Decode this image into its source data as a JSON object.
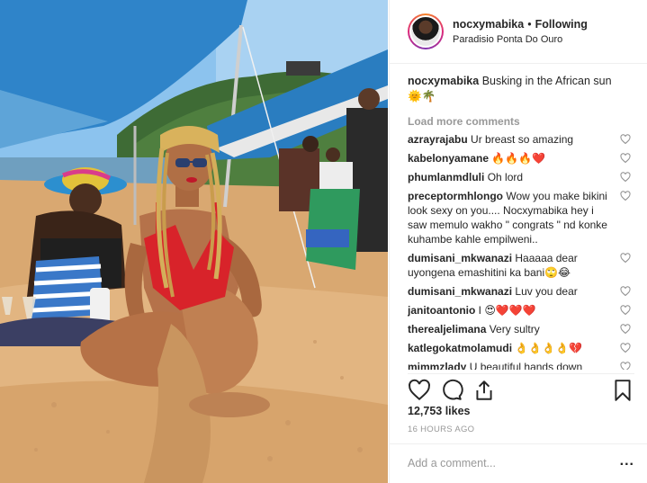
{
  "post": {
    "username": "nocxymabika",
    "dot": "•",
    "following_label": "Following",
    "location": "Paradisio Ponta Do Ouro",
    "caption_username": "nocxymabika",
    "caption_text": "Busking in the African sun 🌞🌴",
    "load_more_label": "Load more comments",
    "likes": "12,753 likes",
    "timestamp": "16 HOURS AGO",
    "comment_placeholder": "Add a comment...",
    "more_options": "..."
  },
  "comments": [
    {
      "user": "azrayrajabu",
      "text": "Ur breast so amazing"
    },
    {
      "user": "kabelonyamane",
      "text": "🔥🔥🔥❤️"
    },
    {
      "user": "phumlanmdluli",
      "text": "Oh lord"
    },
    {
      "user": "preceptormhlongo",
      "text": "Wow you make bikini look sexy on you.... Nocxymabika hey i saw memulo wakho \" congrats \" nd konke kuhambe kahle empilweni.."
    },
    {
      "user": "dumisani_mkwanazi",
      "text": "Haaaaa dear uyongena emashitini ka bani🙄😂"
    },
    {
      "user": "dumisani_mkwanazi",
      "text": "Luv you dear"
    },
    {
      "user": "janitoantonio",
      "text": "I 😍❤️❤️❤️"
    },
    {
      "user": "therealjelimana",
      "text": "Very sultry"
    },
    {
      "user": "katlegokatmolamudi",
      "text": "👌👌👌👌💔"
    },
    {
      "user": "mimmzlady",
      "text": "U beautiful hands down"
    }
  ],
  "icons": {
    "like": "heart-icon",
    "comment": "comment-icon",
    "share": "share-icon",
    "save": "bookmark-icon",
    "comment_like": "heart-icon"
  },
  "colors": {
    "text": "#262626",
    "muted": "#999999",
    "border": "#efefef",
    "sky": "#7fb6e6",
    "tent": "#2b7fc4",
    "sand": "#dcae76",
    "bikini": "#d8232a"
  }
}
